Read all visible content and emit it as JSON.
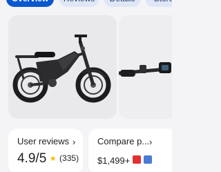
{
  "tabs": [
    {
      "label": "Overview",
      "active": true
    },
    {
      "label": "Reviews"
    },
    {
      "label": "Details"
    },
    {
      "label": "Stores"
    }
  ],
  "gallery": {
    "main_image": "electric-bike-photo",
    "second_image": "handlebar-display-photo"
  },
  "reviews_card": {
    "title": "User reviews",
    "rating": "4.9/5",
    "star": "★",
    "count": "(335)"
  },
  "compare_card": {
    "title": "Compare p...",
    "price": "$1,499+",
    "store_icons": [
      "store-icon-red",
      "store-icon-blue"
    ]
  },
  "colors": {
    "accent": "#0b57d0",
    "chip_bg": "#dfe7f6",
    "star": "#fbbc04"
  }
}
